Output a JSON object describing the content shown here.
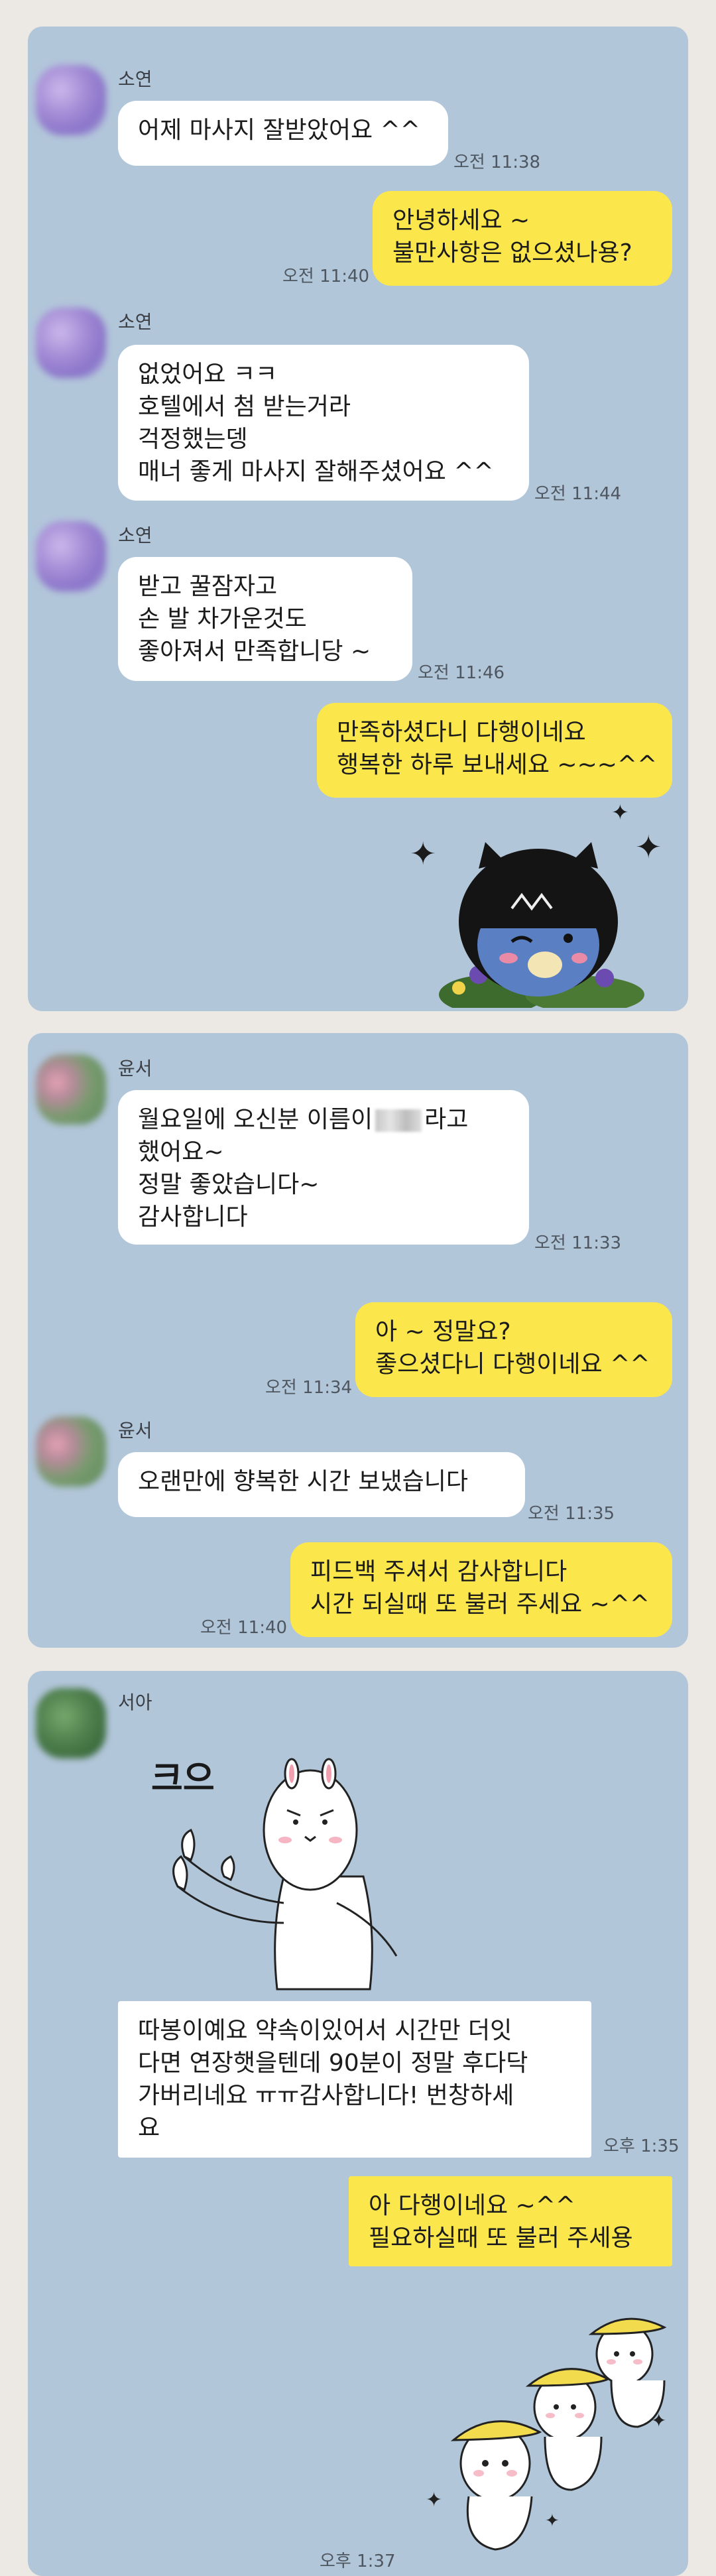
{
  "chat1": {
    "name1": "소연",
    "msg1": "어제 마사지 잘받았어요 ^^",
    "time1": "오전 11:38",
    "reply1": "안녕하세요 ~\n불만사항은 없으셨나용?",
    "reply1_time": "오전 11:40",
    "name2": "소연",
    "msg2": "없었어요 ㅋㅋ\n호텔에서 첨 받는거라\n걱정했는뎅\n매너 좋게 마사지 잘해주셨어요 ^^",
    "time2": "오전 11:44",
    "name3": "소연",
    "msg3": "받고 꿀잠자고\n손 발 차가운것도\n좋아져서 만족합니당 ~",
    "time3": "오전 11:46",
    "reply2": "만족하셨다니 다행이네요\n행복한 하루 보내세요 ~~~^^",
    "sticker": "kakao-friends-sticker"
  },
  "chat2": {
    "name1": "윤서",
    "msg1_a": "월요일에 오신분 이름이",
    "msg1_b": "라고",
    "msg1_rest": "했어요~\n정말 좋았습니다~\n감사합니다",
    "time1": "오전 11:33",
    "reply1": "아 ~ 정말요?\n좋으셨다니 다행이네요 ^^",
    "reply1_time": "오전 11:34",
    "name2": "윤서",
    "msg2": "오랜만에 향복한 시간 보냈습니다",
    "time2": "오전 11:35",
    "reply2": "피드백 주셔서 감사합니다\n시간 되실때 또 불러 주세요 ~^^",
    "reply2_time": "오전 11:40"
  },
  "chat3": {
    "name1": "서아",
    "sticker_text": "크으",
    "msg1": "따봉이예요 약속이있어서 시간만 더잇\n다면 연장햇을텐데 90분이 정말 후다닥\n가버리네요 ㅠㅠ감사합니다! 번창하세\n요",
    "time1": "오후 1:35",
    "reply1": "아 다행이네요 ~^^\n필요하실때 또 불러 주세용",
    "sticker_time": "오후 1:37"
  },
  "colors": {
    "panel": "#b2c6da",
    "yellow_bubble": "#fbe74c",
    "white_bubble": "#ffffff",
    "background": "#ece9e5"
  }
}
